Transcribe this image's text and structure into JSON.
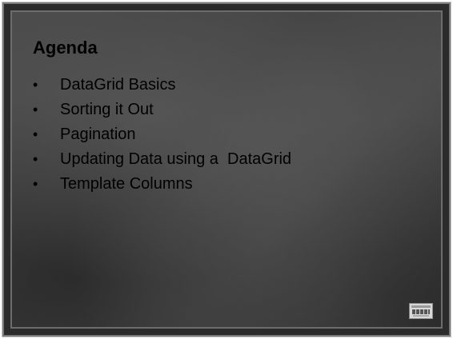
{
  "slide": {
    "title": "Agenda",
    "bullet_glyph": "•",
    "items": [
      {
        "label": "DataGrid Basics"
      },
      {
        "label": "Sorting it Out"
      },
      {
        "label": "Pagination"
      },
      {
        "label": "Updating Data using a  DataGrid"
      },
      {
        "label": "Template Columns"
      }
    ],
    "logo_icon": "aspnet-logo-icon",
    "colors": {
      "background": "#444444",
      "text": "#000000",
      "frame": "#2b2b2b"
    }
  }
}
